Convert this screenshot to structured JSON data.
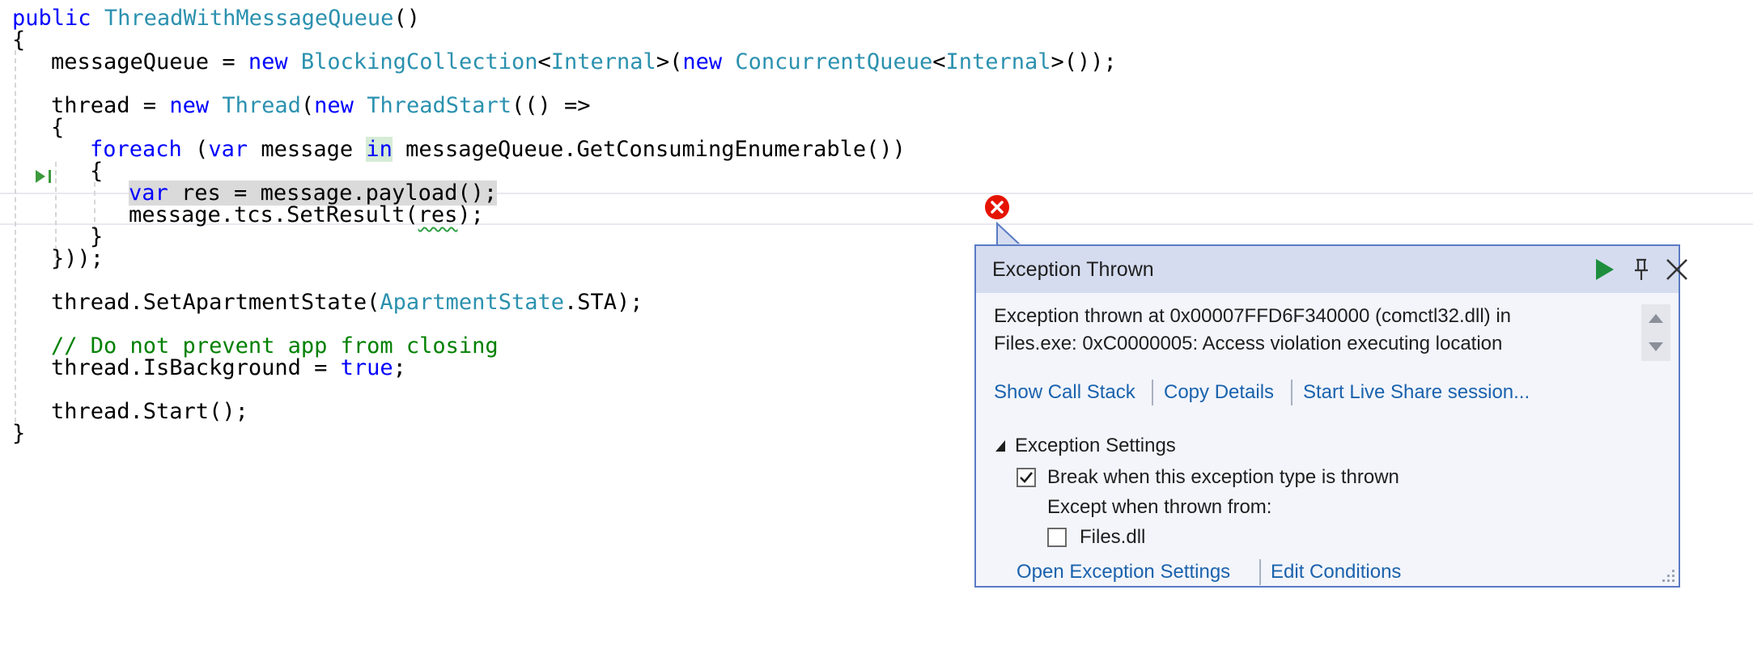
{
  "editor": {
    "lines": [
      [
        {
          "text": "public",
          "cls": "kw"
        },
        {
          "text": " "
        },
        {
          "text": "ThreadWithMessageQueue",
          "cls": "type"
        },
        {
          "text": "()"
        }
      ],
      [
        {
          "text": "{"
        }
      ],
      [
        {
          "text": "messageQueue = "
        },
        {
          "text": "new",
          "cls": "kw"
        },
        {
          "text": " "
        },
        {
          "text": "BlockingCollection",
          "cls": "type"
        },
        {
          "text": "<"
        },
        {
          "text": "Internal",
          "cls": "type"
        },
        {
          "text": ">("
        },
        {
          "text": "new",
          "cls": "kw"
        },
        {
          "text": " "
        },
        {
          "text": "ConcurrentQueue",
          "cls": "type"
        },
        {
          "text": "<"
        },
        {
          "text": "Internal",
          "cls": "type"
        },
        {
          "text": ">());"
        }
      ],
      [],
      [
        {
          "text": "thread = "
        },
        {
          "text": "new",
          "cls": "kw"
        },
        {
          "text": " "
        },
        {
          "text": "Thread",
          "cls": "type"
        },
        {
          "text": "("
        },
        {
          "text": "new",
          "cls": "kw"
        },
        {
          "text": " "
        },
        {
          "text": "ThreadStart",
          "cls": "type"
        },
        {
          "text": "(() =>"
        }
      ],
      [
        {
          "text": "{"
        }
      ],
      [
        {
          "text": "foreach",
          "cls": "kw"
        },
        {
          "text": " ("
        },
        {
          "text": "var",
          "cls": "kw"
        },
        {
          "text": " message "
        },
        {
          "text": "in",
          "cls": "kw hl-in"
        },
        {
          "text": " messageQueue.GetConsumingEnumerable())"
        }
      ],
      [
        {
          "text": "{"
        }
      ],
      [
        {
          "text": "var",
          "cls": "kw hl-stmt"
        },
        {
          "text": " res = message.payload();",
          "cls": "hl-stmt"
        }
      ],
      [
        {
          "text": "message.tcs.SetResult("
        },
        {
          "text": "res",
          "cls": "squiggle"
        },
        {
          "text": ");"
        }
      ],
      [
        {
          "text": "}"
        }
      ],
      [
        {
          "text": "}));"
        }
      ],
      [],
      [
        {
          "text": "thread.SetApartmentState("
        },
        {
          "text": "ApartmentState",
          "cls": "type"
        },
        {
          "text": ".STA);"
        }
      ],
      [],
      [
        {
          "text": "// Do not prevent app from closing",
          "cls": "cm"
        }
      ],
      [
        {
          "text": "thread.IsBackground = "
        },
        {
          "text": "true",
          "cls": "kw"
        },
        {
          "text": ";"
        }
      ],
      [],
      [
        {
          "text": "thread.Start();"
        }
      ],
      [
        {
          "text": "}"
        }
      ]
    ]
  },
  "popup": {
    "title": "Exception Thrown",
    "message_line1": "Exception thrown at 0x00007FFD6F340000 (comctl32.dll) in",
    "message_line2": "Files.exe: 0xC0000005: Access violation executing location",
    "links": {
      "show_call_stack": "Show Call Stack",
      "copy_details": "Copy Details",
      "live_share": "Start Live Share session..."
    },
    "settings": {
      "heading": "Exception Settings",
      "break_label": "Break when this exception type is thrown",
      "break_checked": true,
      "except_label": "Except when thrown from:",
      "files_dll_label": "Files.dll",
      "files_dll_checked": false
    },
    "footer_links": {
      "open_settings": "Open Exception Settings",
      "edit_conditions": "Edit Conditions"
    }
  },
  "colors": {
    "keyword": "#0000ff",
    "type": "#2b91af",
    "comment": "#008000",
    "link": "#1a62ad",
    "error": "#e51400",
    "continue": "#1e8e3e"
  }
}
